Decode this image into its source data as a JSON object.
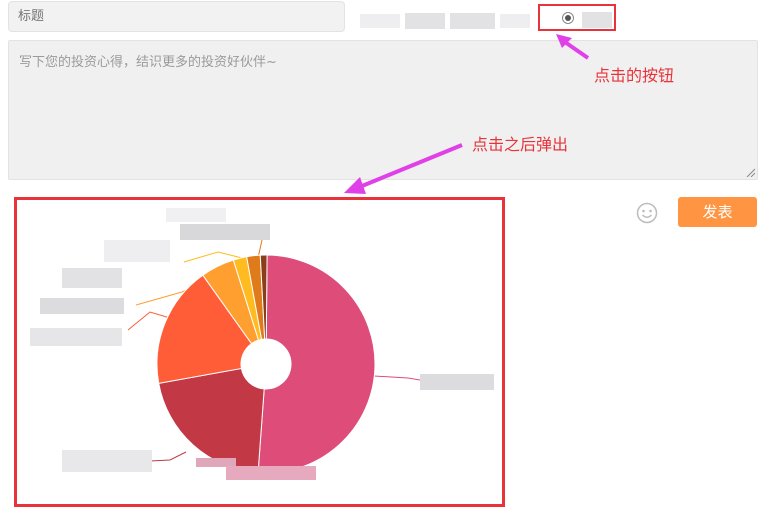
{
  "title_field": {
    "placeholder": "标题"
  },
  "note_field": {
    "placeholder": "写下您的投资心得，结识更多的投资好伙伴~"
  },
  "annotations": {
    "button_label": "点击的按钮",
    "popup_label": "点击之后弹出"
  },
  "publish_button": {
    "label": "发表"
  },
  "icons": {
    "emoji": "smiley-face-icon",
    "radio": "radio-selected-icon"
  },
  "colors": {
    "highlight": "#e8333a",
    "arrow": "#e040e8",
    "publish": "#ff9543"
  },
  "chart_data": {
    "type": "pie",
    "variant": "donut",
    "labels_obscured": true,
    "slices": [
      {
        "value": 51,
        "color": "#de4c7a"
      },
      {
        "value": 21,
        "color": "#c23844"
      },
      {
        "value": 18,
        "color": "#ff5c38"
      },
      {
        "value": 5,
        "color": "#ff9f2f"
      },
      {
        "value": 2,
        "color": "#ffbb1f"
      },
      {
        "value": 2,
        "color": "#e07b1b"
      },
      {
        "value": 1,
        "color": "#8a3f1a"
      }
    ]
  }
}
